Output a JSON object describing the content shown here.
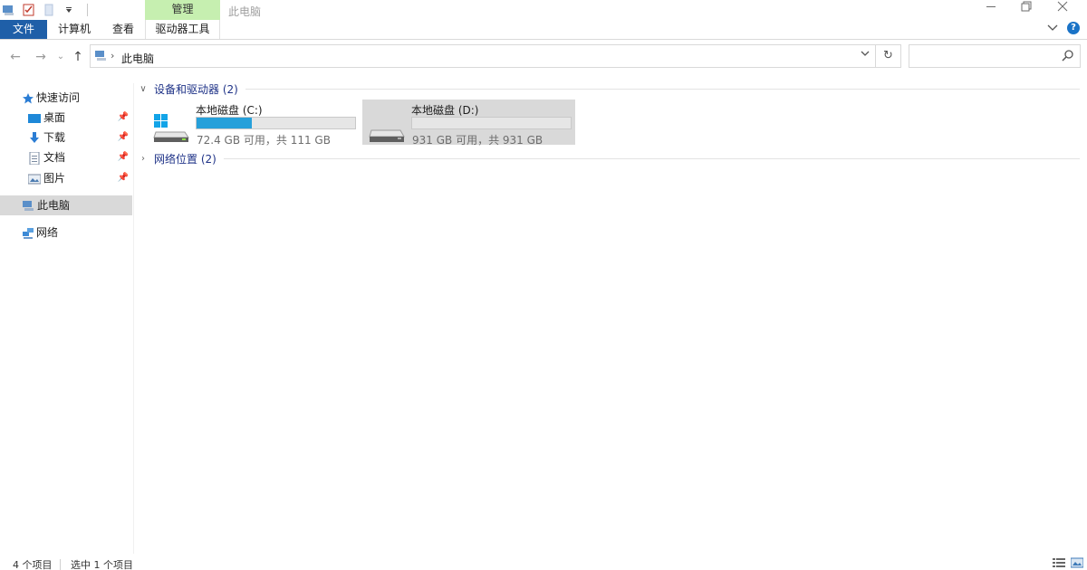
{
  "titlebar": {
    "manage_tab": "管理",
    "window_title": "此电脑",
    "minimize": "—",
    "maximize": "❐",
    "close": "✕"
  },
  "ribbon": {
    "tabs": [
      {
        "label": "文件"
      },
      {
        "label": "计算机"
      },
      {
        "label": "查看"
      },
      {
        "label": "驱动器工具"
      }
    ],
    "expand_icon": "chevron-down-icon",
    "help": "?"
  },
  "nav": {
    "back": "←",
    "forward": "→",
    "recent": "⌄",
    "up": "↑",
    "breadcrumb": "此电脑",
    "search_placeholder": ""
  },
  "sidebar": {
    "quick_access": "快速访问",
    "items": [
      {
        "label": "桌面",
        "icon": "desktop-icon",
        "pinned": true
      },
      {
        "label": "下载",
        "icon": "download-icon",
        "pinned": true
      },
      {
        "label": "文档",
        "icon": "document-icon",
        "pinned": true
      },
      {
        "label": "图片",
        "icon": "pictures-icon",
        "pinned": true
      }
    ],
    "this_pc": "此电脑",
    "network": "网络"
  },
  "main": {
    "devices_group": "设备和驱动器 (2)",
    "drives": [
      {
        "name": "本地磁盘 (C:)",
        "free_text": "72.4 GB 可用，共 111 GB",
        "used_fraction": 0.35,
        "icon": "windows-drive-icon"
      },
      {
        "name": "本地磁盘 (D:)",
        "free_text": "931 GB 可用，共 931 GB",
        "used_fraction": 0.0,
        "icon": "hard-drive-icon"
      }
    ],
    "network_group": "网络位置 (2)"
  },
  "status": {
    "items_count": "4 个项目",
    "selected": "选中 1 个项目"
  },
  "colors": {
    "accent": "#1f5fa8",
    "manage_tab": "#c6efb0",
    "usage_bar": "#26a0da",
    "selection": "#d9d9d9",
    "group_title": "#1e3287"
  }
}
